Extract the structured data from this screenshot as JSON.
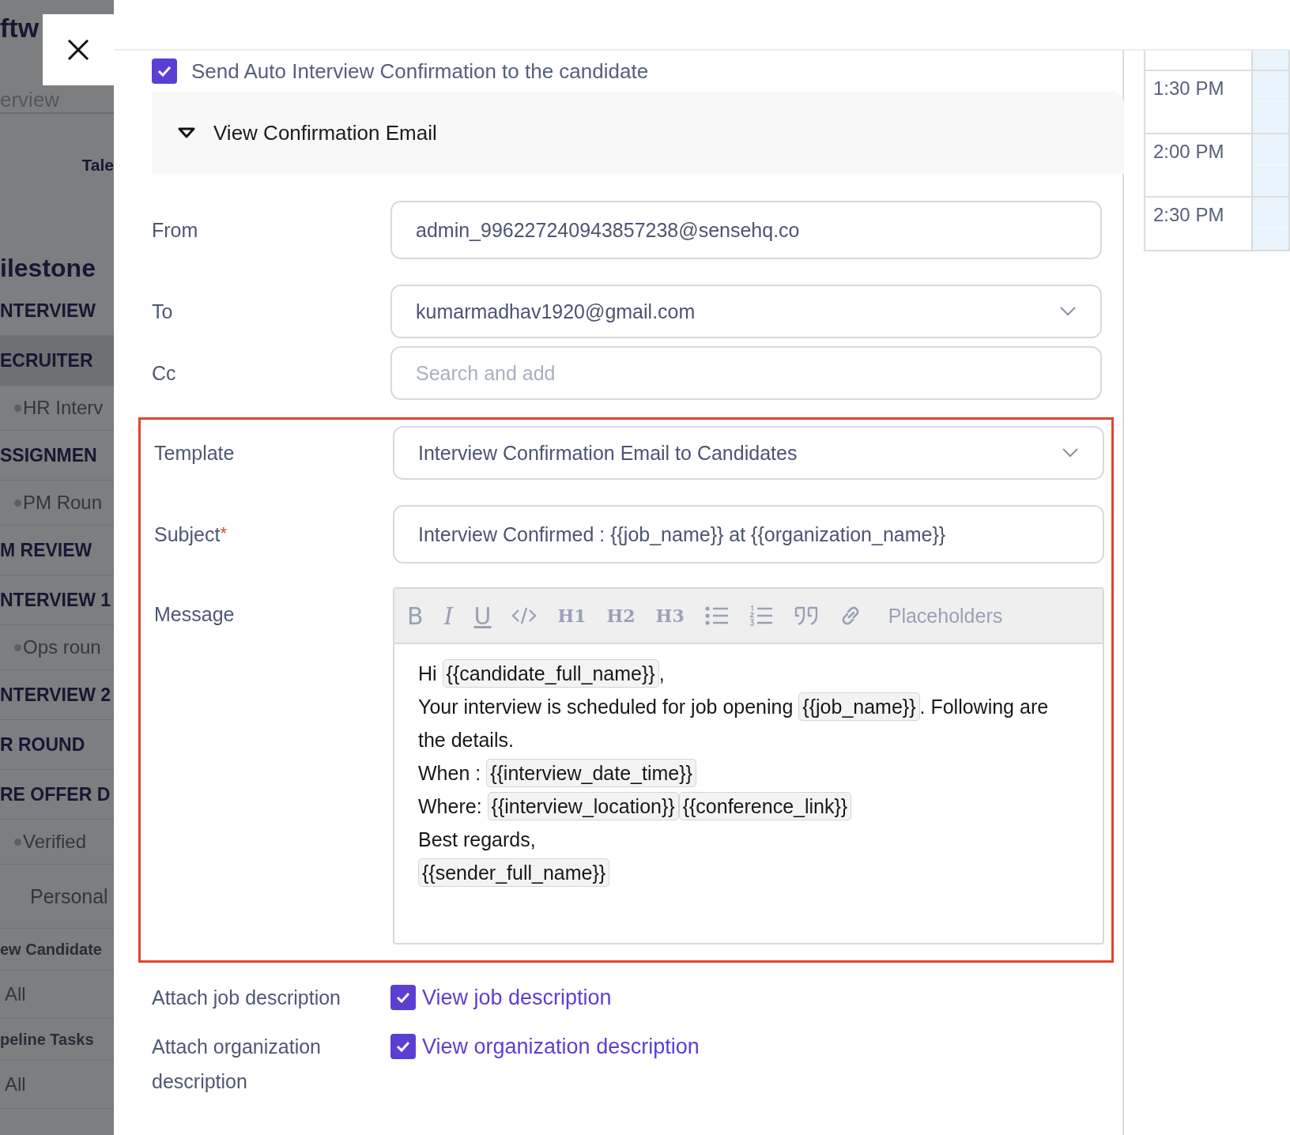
{
  "sidebar": {
    "items": [
      {
        "kind": "title",
        "text": "ftw"
      },
      {
        "kind": "link",
        "text": "erview"
      },
      {
        "kind": "divider"
      },
      {
        "kind": "tab",
        "text": "Tale"
      },
      {
        "kind": "heading",
        "text": "ilestone"
      },
      {
        "kind": "stage",
        "text": "NTERVIEW",
        "selected": false
      },
      {
        "kind": "stage",
        "text": "ECRUITER",
        "selected": true
      },
      {
        "kind": "sub",
        "text": "HR Interv"
      },
      {
        "kind": "stage",
        "text": "SSIGNMEN",
        "selected": false
      },
      {
        "kind": "sub",
        "text": "PM Roun"
      },
      {
        "kind": "stage",
        "text": "M REVIEW",
        "selected": false
      },
      {
        "kind": "stage",
        "text": "NTERVIEW 1",
        "selected": false
      },
      {
        "kind": "sub",
        "text": "Ops roun"
      },
      {
        "kind": "stage",
        "text": "NTERVIEW 2",
        "selected": false
      },
      {
        "kind": "stage",
        "text": "R ROUND",
        "selected": false
      },
      {
        "kind": "stage",
        "text": "RE OFFER D",
        "selected": false
      },
      {
        "kind": "sub",
        "text": "Verified"
      },
      {
        "kind": "plain",
        "text": "Personal"
      },
      {
        "kind": "section",
        "text": "ew Candidate"
      },
      {
        "kind": "filter",
        "text": "All"
      },
      {
        "kind": "section",
        "text": "peline Tasks"
      },
      {
        "kind": "filter",
        "text": "All"
      }
    ]
  },
  "auto_confirmation": {
    "label": "Send Auto Interview Confirmation to the candidate",
    "checked": true
  },
  "email_panel": {
    "title": "View Confirmation Email",
    "expanded": true
  },
  "fields": [
    {
      "kind": "text",
      "label": "From",
      "value": "admin_996227240943857238@sensehq.co"
    },
    {
      "kind": "select",
      "label": "To",
      "value": "kumarmadhav1920@gmail.com"
    },
    {
      "kind": "search",
      "label": "Cc",
      "placeholder": "Search and add"
    }
  ],
  "highlighted_section": {
    "highlighted": true,
    "template": {
      "label": "Template",
      "value": "Interview Confirmation Email to Candidates"
    },
    "subject": {
      "label": "Subject",
      "required_mark": "*",
      "value": "Interview Confirmed : {{job_name}} at {{organization_name}}"
    },
    "message": {
      "label": "Message",
      "toolbar": [
        {
          "kind": "bold",
          "label": "B"
        },
        {
          "kind": "italic",
          "label": "I"
        },
        {
          "kind": "underline",
          "label": "U"
        },
        {
          "kind": "code"
        },
        {
          "kind": "heading",
          "label": "H1"
        },
        {
          "kind": "heading",
          "label": "H2"
        },
        {
          "kind": "heading",
          "label": "H3"
        },
        {
          "kind": "bullets"
        },
        {
          "kind": "numbers"
        },
        {
          "kind": "quote"
        },
        {
          "kind": "link"
        },
        {
          "kind": "menu",
          "label": "Placeholders"
        }
      ],
      "paragraphs": [
        [
          {
            "kind": "text",
            "text": "Hi "
          },
          {
            "kind": "placeholder",
            "text": "{{candidate_full_name}}"
          },
          {
            "kind": "text",
            "text": ","
          }
        ],
        [
          {
            "kind": "text",
            "text": "Your interview is scheduled for job opening "
          },
          {
            "kind": "placeholder",
            "text": "{{job_name}}"
          },
          {
            "kind": "text",
            "text": ". Following are the details."
          }
        ],
        [
          {
            "kind": "text",
            "text": "When : "
          },
          {
            "kind": "placeholder",
            "text": "{{interview_date_time}}"
          }
        ],
        [
          {
            "kind": "text",
            "text": "Where: "
          },
          {
            "kind": "placeholder",
            "text": "{{interview_location}}"
          },
          {
            "kind": "placeholder",
            "text": "{{conference_link}}"
          }
        ],
        [
          {
            "kind": "text",
            "text": "Best regards,"
          }
        ],
        [
          {
            "kind": "placeholder",
            "text": "{{sender_full_name}}"
          }
        ]
      ]
    }
  },
  "attachments": [
    {
      "label": "Attach job description",
      "link": "View job description",
      "checked": true
    },
    {
      "label": "Attach organization description",
      "link": "View organization description",
      "checked": true
    }
  ],
  "calendar": {
    "times": [
      "1:30 PM",
      "2:00 PM",
      "2:30 PM"
    ]
  }
}
